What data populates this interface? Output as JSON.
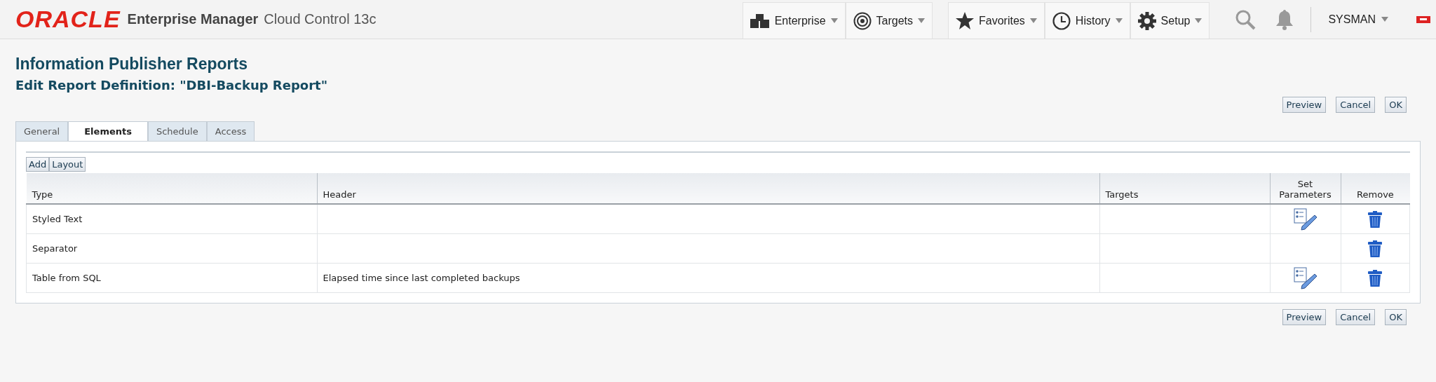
{
  "header": {
    "logo": "ORACLE",
    "product": "Enterprise Manager",
    "edition": "Cloud Control 13c",
    "menu_groups": [
      [
        {
          "label": "Enterprise",
          "kind": "enterprise"
        },
        {
          "label": "Targets",
          "kind": "targets"
        }
      ],
      [
        {
          "label": "Favorites",
          "kind": "favorites"
        },
        {
          "label": "History",
          "kind": "history"
        },
        {
          "label": "Setup",
          "kind": "setup"
        }
      ]
    ],
    "user": "SYSMAN"
  },
  "page": {
    "title": "Information Publisher Reports",
    "subtitle": "Edit Report Definition: \"DBI-Backup Report\""
  },
  "actions_top": [
    "Preview",
    "Cancel",
    "OK"
  ],
  "tabs": [
    {
      "label": "General",
      "selected": false
    },
    {
      "label": "Elements",
      "selected": true
    },
    {
      "label": "Schedule",
      "selected": false
    },
    {
      "label": "Access",
      "selected": false
    }
  ],
  "toolbar": [
    "Add",
    "Layout"
  ],
  "table": {
    "columns": [
      "Type",
      "Header",
      "Targets",
      "Set Parameters",
      "Remove"
    ],
    "rows": [
      {
        "type": "Styled Text",
        "set_parameters": true,
        "removable": true
      },
      {
        "type": "Separator",
        "set_parameters": false,
        "removable": true
      },
      {
        "type": "Table from SQL",
        "header": "Elapsed time since last completed backups",
        "set_parameters": true,
        "removable": true
      }
    ]
  },
  "actions_bottom": [
    "Preview",
    "Cancel",
    "OK"
  ]
}
